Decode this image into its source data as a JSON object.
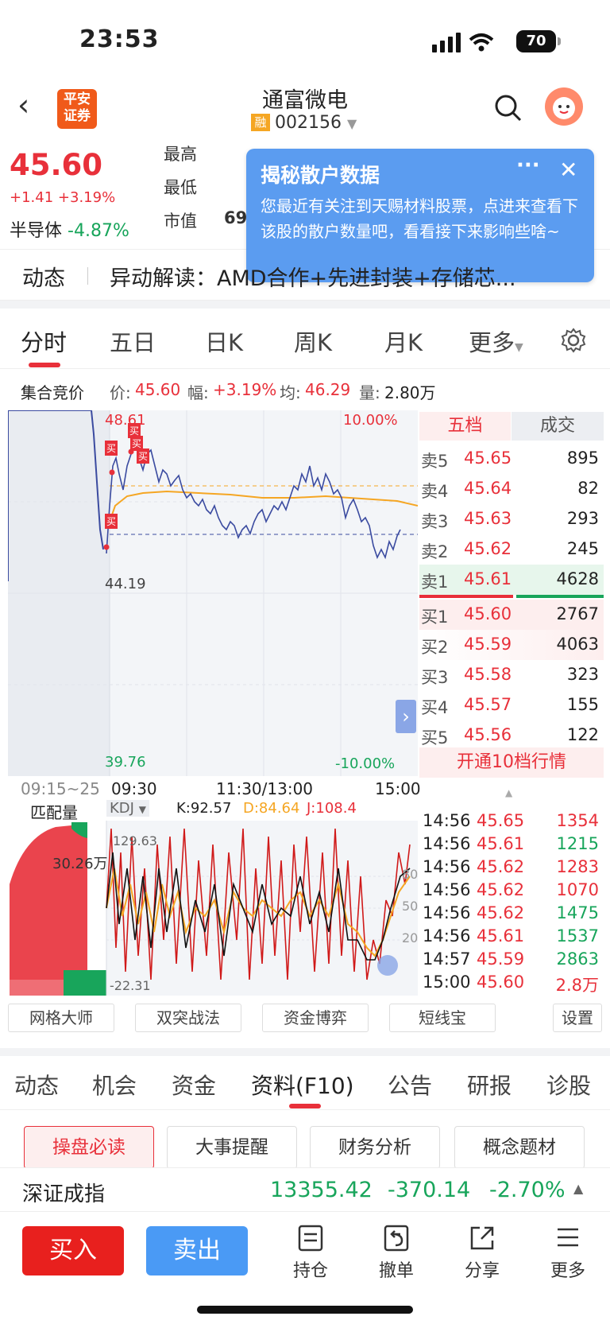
{
  "status": {
    "time": "23:53",
    "battery": "70"
  },
  "header": {
    "logo": "平安\n证券",
    "name": "通富微电",
    "rong": "融",
    "code": "002156"
  },
  "quote": {
    "price": "45.60",
    "change": "+1.41",
    "pct": "+3.19%",
    "sector": "半导体",
    "sector_pct": "-4.87%",
    "lbl_high": "最高",
    "lbl_low": "最低",
    "lbl_cap": "市值",
    "cap_partial": "69"
  },
  "popup": {
    "title": "揭秘散户数据",
    "more": "···",
    "close": "✕",
    "body": "您最近有关注到天赐材料股票，点进来查看下该股的散户数量吧，看看接下来影响些啥~"
  },
  "news": {
    "tag": "动态",
    "text": "异动解读：AMD合作+先进封装+存储芯..."
  },
  "chart_tabs": [
    "分时",
    "五日",
    "日K",
    "周K",
    "月K",
    "更多"
  ],
  "info": {
    "label": "集合竞价",
    "price_lbl": "价:",
    "price": "45.60",
    "amp_lbl": "幅:",
    "amp": "+3.19%",
    "avg_lbl": "均:",
    "avg": "46.29",
    "vol_lbl": "量:",
    "vol": "2.80万"
  },
  "chart_labels": {
    "top": "48.61",
    "mid": "44.19",
    "bottom": "39.76",
    "pct_top": "10.00%",
    "pct_bottom": "-10.00%",
    "buy": "买",
    "arrow": "›"
  },
  "time_axis": {
    "auction": "09:15~25",
    "t1": "09:30",
    "t2": "11:30/13:00",
    "t3": "15:00"
  },
  "kdj": {
    "tab": "匹配量",
    "name": "KDJ",
    "k": "K:92.57",
    "d": "D:84.64",
    "j": "J:108.4",
    "vol": "30.26万",
    "top": "129.63",
    "bottom": "-22.31",
    "l80": "80",
    "l50": "50",
    "l20": "20"
  },
  "orderbook": {
    "tabs": [
      "五档",
      "成交"
    ],
    "asks": [
      {
        "l": "卖5",
        "p": "45.65",
        "v": "895"
      },
      {
        "l": "卖4",
        "p": "45.64",
        "v": "82"
      },
      {
        "l": "卖3",
        "p": "45.63",
        "v": "293"
      },
      {
        "l": "卖2",
        "p": "45.62",
        "v": "245"
      },
      {
        "l": "卖1",
        "p": "45.61",
        "v": "4628"
      }
    ],
    "bids": [
      {
        "l": "买1",
        "p": "45.60",
        "v": "2767"
      },
      {
        "l": "买2",
        "p": "45.59",
        "v": "4063"
      },
      {
        "l": "买3",
        "p": "45.58",
        "v": "323"
      },
      {
        "l": "买4",
        "p": "45.57",
        "v": "155"
      },
      {
        "l": "买5",
        "p": "45.56",
        "v": "122"
      }
    ],
    "upgrade": "开通10档行情"
  },
  "trades": [
    {
      "t": "14:56",
      "p": "45.65",
      "v": "1354",
      "c": "red"
    },
    {
      "t": "14:56",
      "p": "45.61",
      "v": "1215",
      "c": "green"
    },
    {
      "t": "14:56",
      "p": "45.62",
      "v": "1283",
      "c": "red"
    },
    {
      "t": "14:56",
      "p": "45.62",
      "v": "1070",
      "c": "red"
    },
    {
      "t": "14:56",
      "p": "45.62",
      "v": "1475",
      "c": "green"
    },
    {
      "t": "14:56",
      "p": "45.61",
      "v": "1537",
      "c": "green"
    },
    {
      "t": "14:57",
      "p": "45.59",
      "v": "2863",
      "c": "green"
    },
    {
      "t": "15:00",
      "p": "45.60",
      "v": "2.8万",
      "c": "red"
    }
  ],
  "tools": [
    "网格大师",
    "双突战法",
    "资金博弈",
    "短线宝",
    "设置"
  ],
  "bottom_tabs": [
    "动态",
    "机会",
    "资金",
    "资料(F10)",
    "公告",
    "研报",
    "诊股"
  ],
  "sub_tabs": [
    "操盘必读",
    "大事提醒",
    "财务分析",
    "概念题材"
  ],
  "ticker": {
    "name": "深证成指",
    "value": "13355.42",
    "chg": "-370.14",
    "pct": "-2.70%"
  },
  "actions": {
    "buy": "买入",
    "sell": "卖出",
    "hold": "持仓",
    "cancel": "撤单",
    "share": "分享",
    "more": "更多"
  },
  "colors": {
    "up": "#e8303a",
    "down": "#18a55b",
    "accent": "#4a9af5"
  }
}
